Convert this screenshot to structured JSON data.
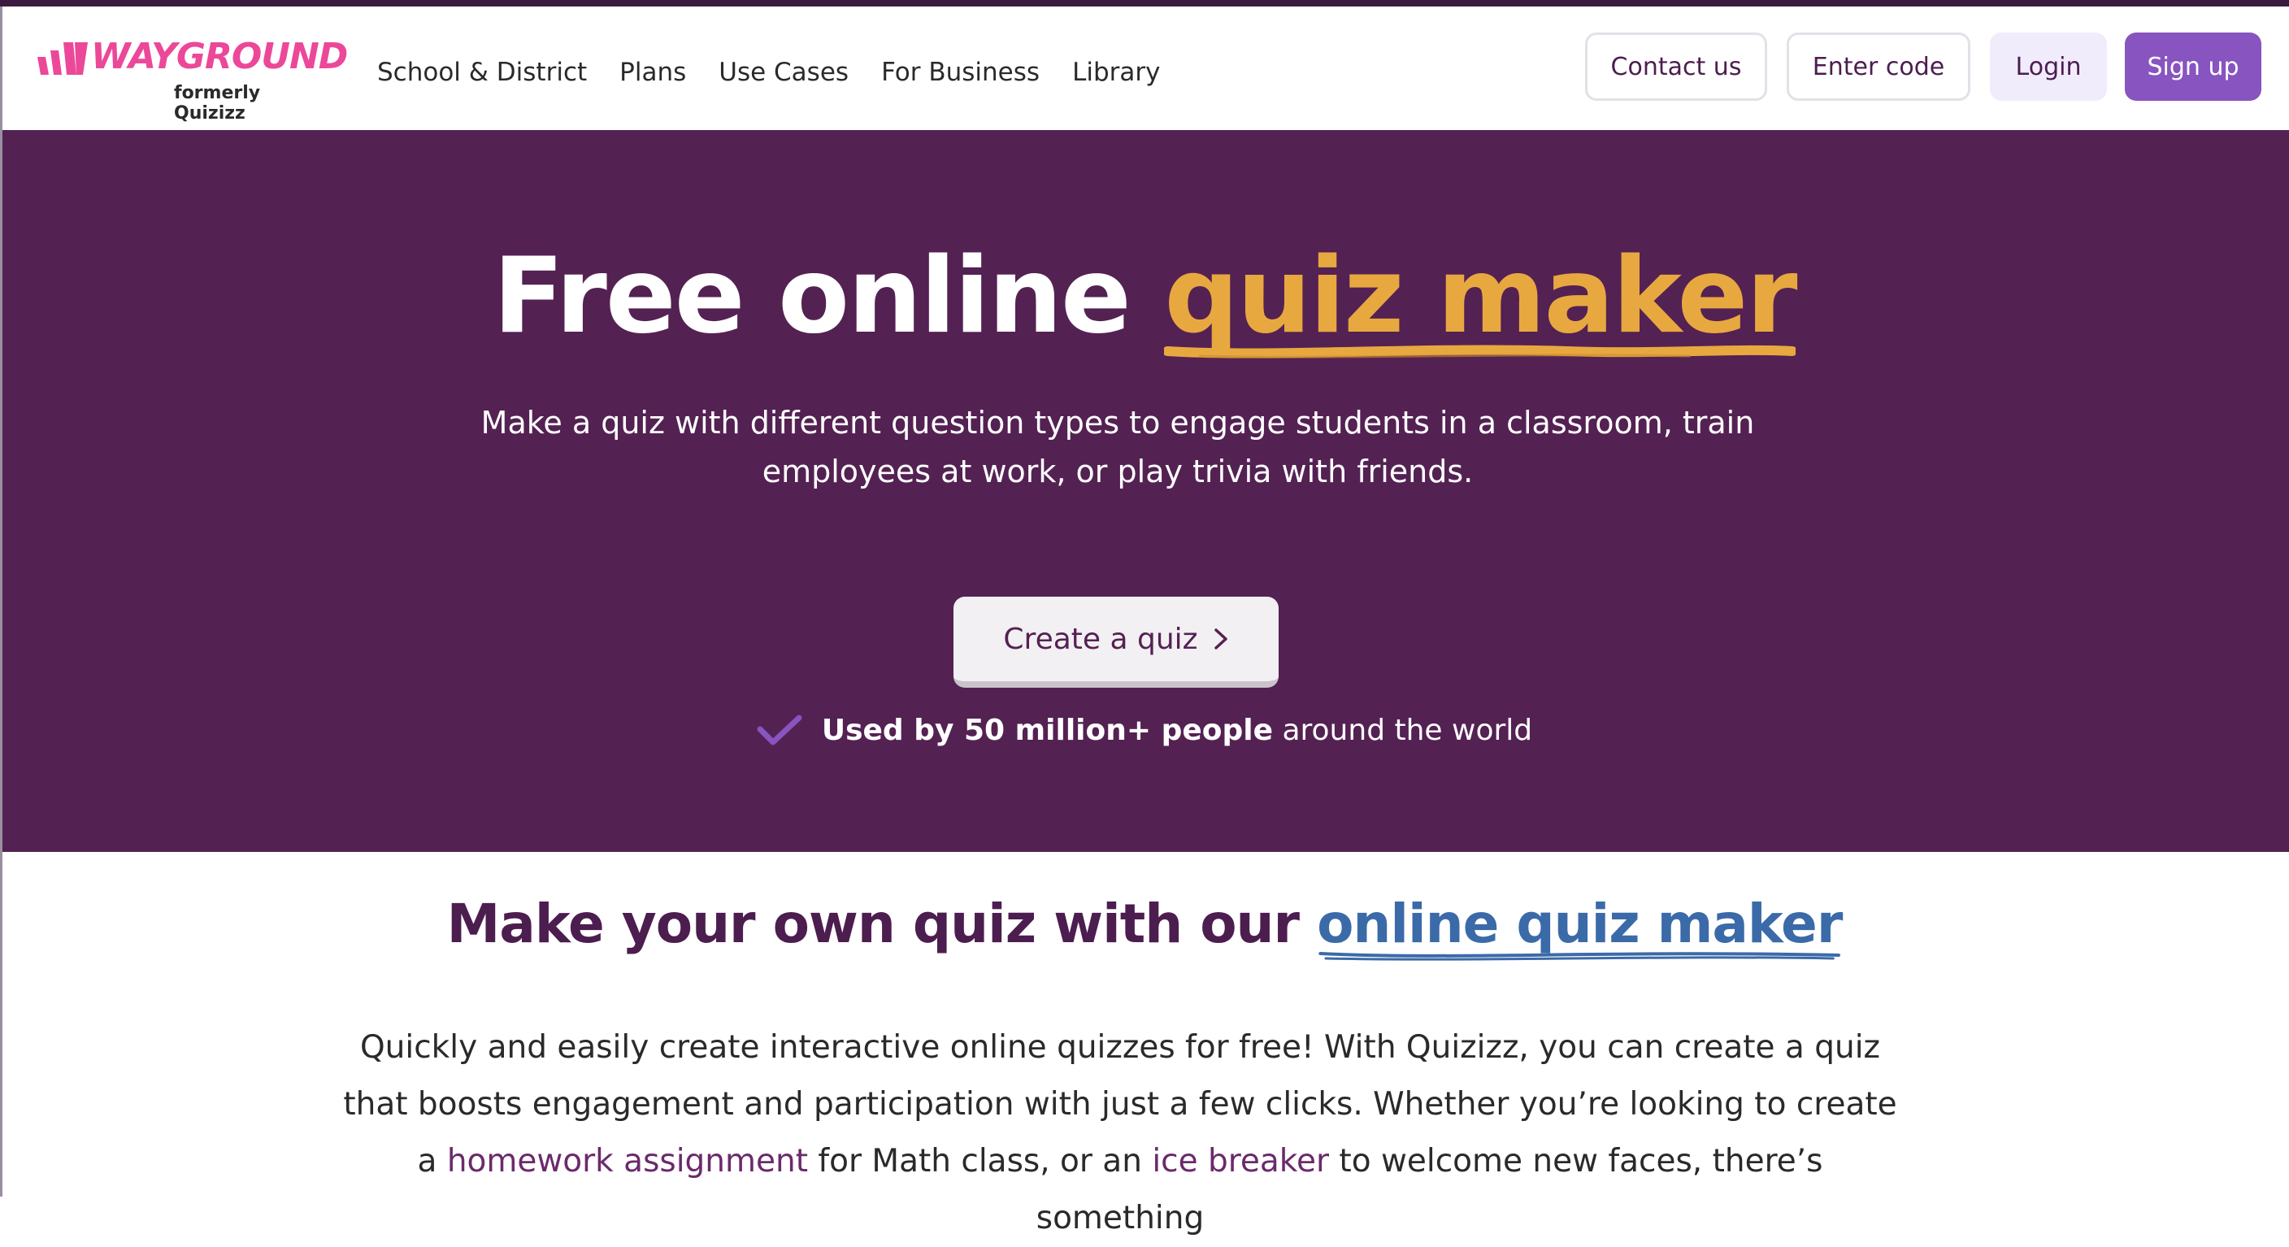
{
  "brand": {
    "name": "WAYGROUND",
    "tagline": "formerly Quizizz",
    "color": "#ec4899"
  },
  "nav": {
    "links": [
      "School & District",
      "Plans",
      "Use Cases",
      "For Business",
      "Library"
    ],
    "contact_label": "Contact us",
    "enter_code_label": "Enter code",
    "login_label": "Login",
    "signup_label": "Sign up"
  },
  "hero": {
    "title_plain": "Free online ",
    "title_accent": "quiz maker",
    "subtitle": "Make a quiz with different question types to engage students in a classroom, train employees at work, or play trivia with friends.",
    "cta_label": "Create a quiz",
    "used_bold": "Used by 50 million+ people",
    "used_rest": " around the world",
    "background": "#542153",
    "accent_color": "#e8a840"
  },
  "section": {
    "title_plain": "Make your own quiz with our ",
    "title_link": "online quiz maker",
    "body_1": "Quickly and easily create interactive online quizzes for free! With Quizizz, you can create a quiz that boosts engagement and participation with just a few clicks. Whether you’re looking to create a ",
    "link_homework": "homework assignment",
    "body_2": " for Math class, or an ",
    "link_icebreaker": "ice breaker",
    "body_3": " to welcome new faces, there’s something"
  },
  "icons": {
    "logo": "wayground-logo-icon",
    "cta": "chevron-right-icon",
    "check": "check-icon"
  }
}
